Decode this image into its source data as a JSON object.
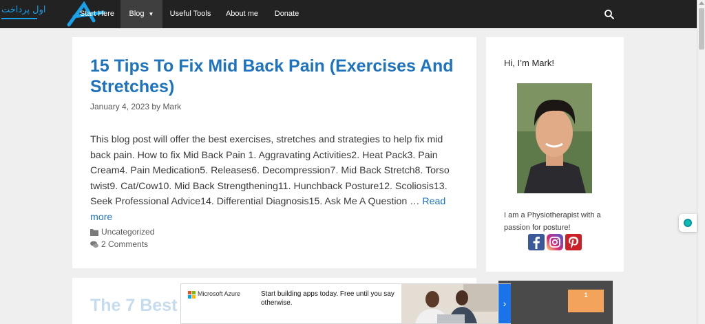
{
  "nav": {
    "logo_text": "اول پرداخت",
    "items": [
      {
        "label": "Start Here"
      },
      {
        "label": "Blog"
      },
      {
        "label": "Useful Tools"
      },
      {
        "label": "About me"
      },
      {
        "label": "Donate"
      }
    ],
    "search_icon": "search-icon"
  },
  "post": {
    "title": "15 Tips To Fix Mid Back Pain (Exercises And Stretches)",
    "date": "January 4, 2023",
    "by": "by",
    "author": "Mark",
    "excerpt": "This blog post will offer the best exercises, stretches and strategies to help fix mid back pain. How to fix Mid Back Pain 1. Aggravating Activities2. Heat Pack3. Pain Cream4. Pain Medication5. Releases6. Decompression7. Mid Back Stretch8. Torso twist9. Cat/Cow10. Mid Back Strengthening11. Hunchback Posture12. Scoliosis13. Seek Professional Advice14. Differential Diagnosis15. Ask Me A Question …",
    "read_more": "Read more",
    "category": "Uncategorized",
    "comments": "2 Comments"
  },
  "next_post": {
    "title_partial": "The 7 Best I"
  },
  "sidebar": {
    "title": "Hi, I’m Mark!",
    "bio": "I am a Physiotherapist with a passion for posture!",
    "social": [
      "facebook-icon",
      "instagram-icon",
      "pinterest-icon"
    ]
  },
  "ad": {
    "brand": "Microsoft Azure",
    "text": "Start building apps today. Free until you say otherwise.",
    "arrow": "›"
  },
  "side_ad": {
    "badge": "1"
  },
  "colors": {
    "nav_bg": "#222222",
    "link": "#1e73be",
    "page_bg": "#efefef"
  }
}
